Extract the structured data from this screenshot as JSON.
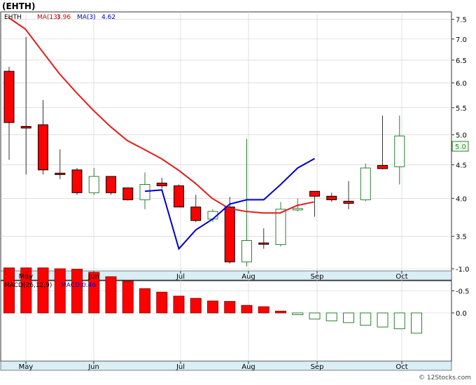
{
  "header": {
    "ticker_title": "(EHTH)"
  },
  "legend_top": {
    "symbol": "EHTH",
    "ma13_label": "MA(13)",
    "ma13_value": "3.96",
    "ma3_label": "MA(3)",
    "ma3_value": "4.62"
  },
  "legend_bottom": {
    "macd_label": "MACD(26,12,9)",
    "macd_value_label": "MACD:0.46"
  },
  "price_badge": "5.0",
  "footer": {
    "credit": "© 12Stocks.com"
  },
  "colors": {
    "up": "#2e7d32",
    "down": "#ff0000",
    "ma13": "#e31b1b",
    "ma3": "#0000cc",
    "axis_band": "#d9eef5",
    "grid": "#cccccc"
  },
  "chart_data": [
    {
      "type": "candlestick",
      "title": "(EHTH)",
      "scale": "log",
      "x_labels": [
        "May",
        "Jun",
        "Jul",
        "Aug",
        "Sep",
        "Oct"
      ],
      "y_ticks": [
        "3.5",
        "4.0",
        "4.5",
        "5.0",
        "5.5",
        "6.0",
        "6.5",
        "7.0",
        "7.5"
      ],
      "ylim": [
        3.1,
        7.7
      ],
      "grid": true,
      "candles": [
        {
          "open": 6.25,
          "high": 6.35,
          "low": 4.58,
          "close": 5.22
        },
        {
          "open": 5.15,
          "high": 7.05,
          "low": 4.35,
          "close": 5.12
        },
        {
          "open": 5.18,
          "high": 5.65,
          "low": 4.35,
          "close": 4.42
        },
        {
          "open": 4.37,
          "high": 4.75,
          "low": 4.28,
          "close": 4.35
        },
        {
          "open": 4.42,
          "high": 4.45,
          "low": 4.05,
          "close": 4.08
        },
        {
          "open": 4.08,
          "high": 4.45,
          "low": 4.05,
          "close": 4.32
        },
        {
          "open": 4.32,
          "high": 4.32,
          "low": 4.05,
          "close": 4.08
        },
        {
          "open": 4.15,
          "high": 4.15,
          "low": 3.97,
          "close": 3.98
        },
        {
          "open": 3.98,
          "high": 4.38,
          "low": 3.85,
          "close": 4.2
        },
        {
          "open": 4.22,
          "high": 4.3,
          "low": 4.14,
          "close": 4.18
        },
        {
          "open": 4.18,
          "high": 4.2,
          "low": 3.88,
          "close": 3.88
        },
        {
          "open": 3.88,
          "high": 4.05,
          "low": 3.68,
          "close": 3.7
        },
        {
          "open": 3.72,
          "high": 3.85,
          "low": 3.68,
          "close": 3.82
        },
        {
          "open": 3.88,
          "high": 4.02,
          "low": 3.18,
          "close": 3.2
        },
        {
          "open": 3.2,
          "high": 4.93,
          "low": 3.15,
          "close": 3.45
        },
        {
          "open": 3.42,
          "high": 3.6,
          "low": 3.35,
          "close": 3.41
        },
        {
          "open": 3.4,
          "high": 3.95,
          "low": 3.38,
          "close": 3.85
        },
        {
          "open": 3.84,
          "high": 4.0,
          "low": 3.82,
          "close": 3.86
        },
        {
          "open": 4.1,
          "high": 4.1,
          "low": 3.75,
          "close": 4.03
        },
        {
          "open": 4.03,
          "high": 4.08,
          "low": 3.95,
          "close": 3.98
        },
        {
          "open": 3.96,
          "high": 4.25,
          "low": 3.85,
          "close": 3.93
        },
        {
          "open": 3.98,
          "high": 4.52,
          "low": 3.96,
          "close": 4.45
        },
        {
          "open": 4.49,
          "high": 5.35,
          "low": 4.43,
          "close": 4.44
        },
        {
          "open": 4.47,
          "high": 5.35,
          "low": 4.2,
          "close": 4.98
        }
      ],
      "ma13": [
        7.55,
        7.25,
        6.7,
        6.2,
        5.8,
        5.45,
        5.15,
        4.9,
        4.75,
        4.6,
        4.42,
        4.22,
        4.0,
        3.86,
        3.82,
        3.8,
        3.8,
        3.9,
        3.95
      ],
      "ma3": [
        4.1,
        4.12,
        3.35,
        3.58,
        3.72,
        3.92,
        3.98,
        3.98,
        4.2,
        4.45,
        4.6
      ]
    },
    {
      "type": "bar",
      "title": "MACD(26,12,9)",
      "y_ticks": [
        "0.0",
        "-0.5",
        "-1.0"
      ],
      "ylim": [
        -1.05,
        0.45
      ],
      "values": [
        -1.02,
        -1.02,
        -1.02,
        -1.0,
        -0.99,
        -0.92,
        -0.82,
        -0.72,
        -0.55,
        -0.47,
        -0.38,
        -0.33,
        -0.27,
        -0.26,
        -0.17,
        -0.14,
        -0.04,
        0.04,
        0.14,
        0.18,
        0.22,
        0.28,
        0.32,
        0.36,
        0.46
      ]
    }
  ]
}
